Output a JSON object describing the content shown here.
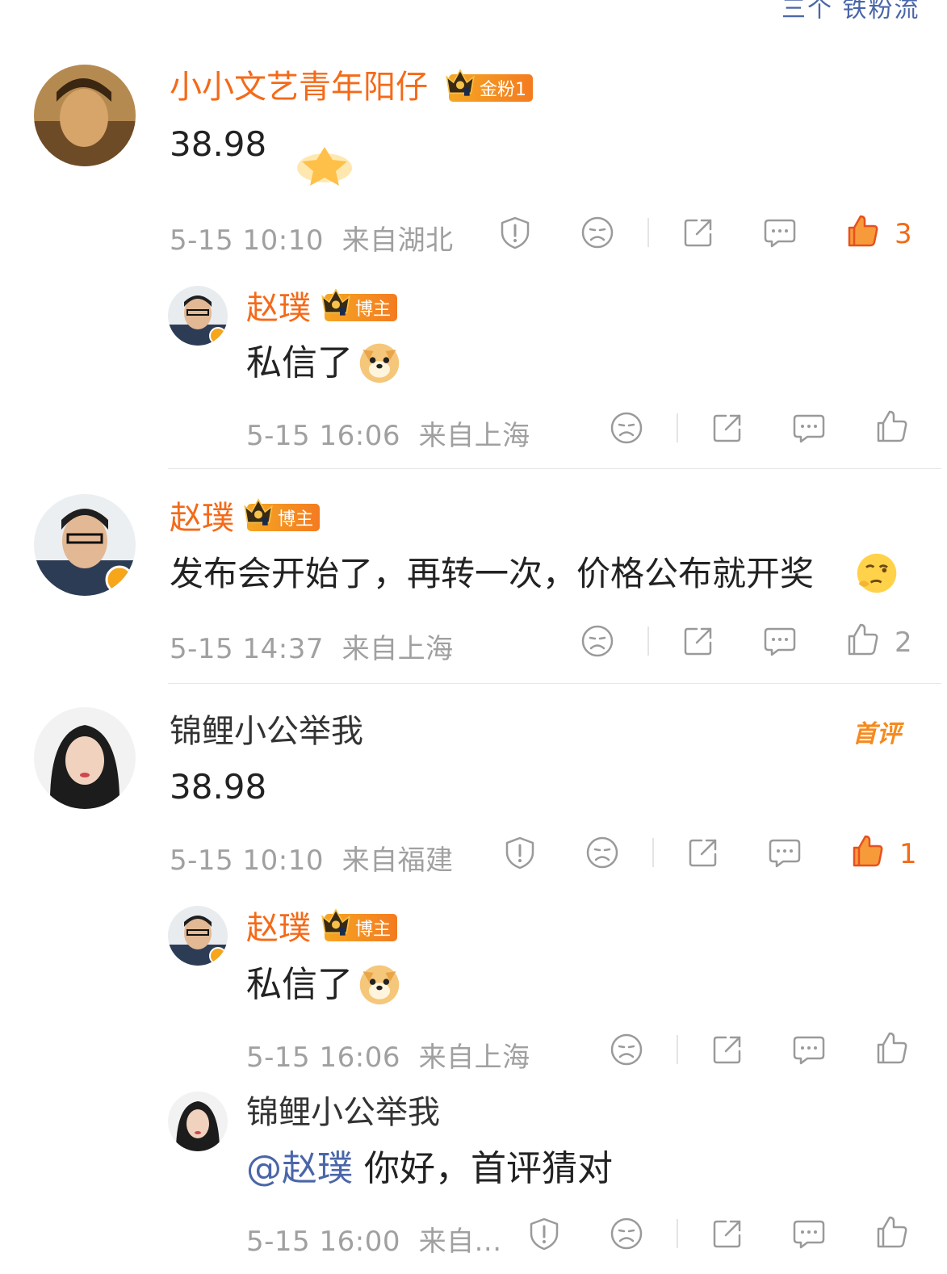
{
  "top_strip": "三个 铁粉流",
  "comments": [
    {
      "user": "小小文艺青年阳仔",
      "badge": "金粉1",
      "text": "38.98",
      "time": "5-15 10:10",
      "location": "来自湖北",
      "likes": "3",
      "liked": true,
      "reply": {
        "user": "赵璞",
        "badge": "博主",
        "text": "私信了",
        "time": "5-15 16:06",
        "location": "来自上海"
      }
    },
    {
      "user": "赵璞",
      "badge": "博主",
      "text": "发布会开始了，再转一次，价格公布就开奖",
      "time": "5-15 14:37",
      "location": "来自上海",
      "likes": "2",
      "liked": false
    },
    {
      "user": "锦鲤小公举我",
      "tag": "首评",
      "text": "38.98",
      "time": "5-15 10:10",
      "location": "来自福建",
      "likes": "1",
      "liked": true,
      "replies": [
        {
          "user": "赵璞",
          "badge": "博主",
          "text": "私信了",
          "time": "5-15 16:06",
          "location": "来自上海"
        },
        {
          "user": "锦鲤小公举我",
          "mention": "@赵璞",
          "text": "你好，首评猜对",
          "time": "5-15 16:00",
          "location": "来自..."
        }
      ]
    }
  ],
  "colors": {
    "accent": "#f46a19",
    "link": "#4a66a8",
    "meta": "#a0a0a0"
  },
  "icons": [
    "report-icon",
    "dislike-icon",
    "share-icon",
    "comment-icon",
    "like-icon"
  ]
}
